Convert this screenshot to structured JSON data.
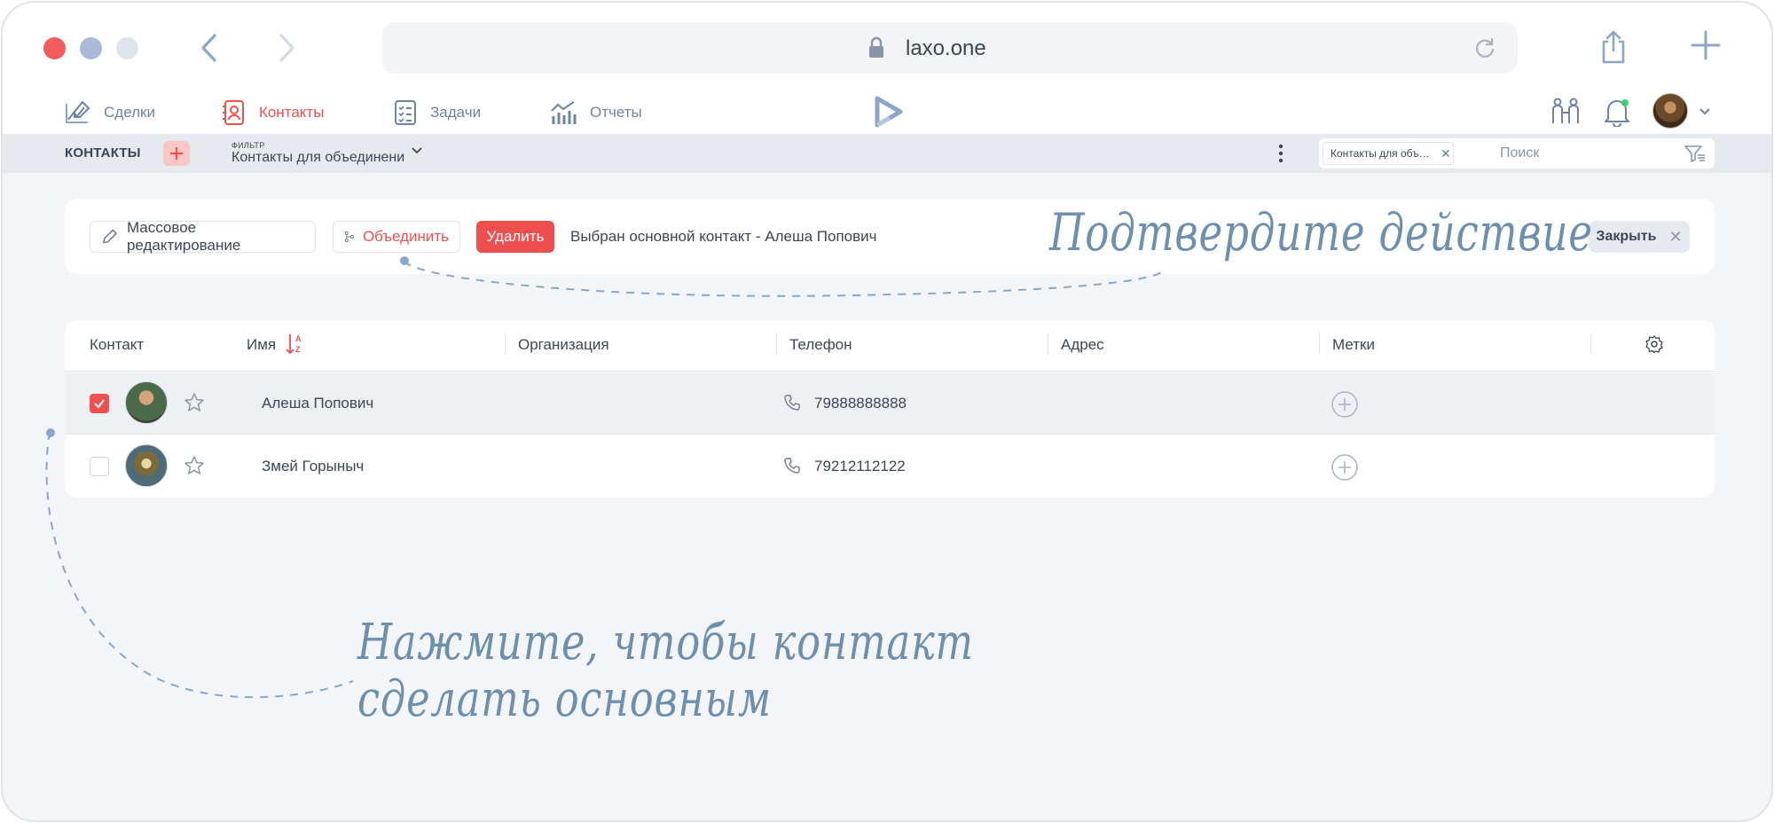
{
  "browser": {
    "url": "laxo.one",
    "icons": [
      "close-dot",
      "minimize-dot",
      "zoom-dot",
      "back-arrow-icon",
      "forward-arrow-icon",
      "lock-icon",
      "reload-icon",
      "share-icon",
      "plus-icon"
    ]
  },
  "nav": {
    "items": [
      {
        "label": "Сделки",
        "icon": "deals-icon",
        "active": false
      },
      {
        "label": "Контакты",
        "icon": "contacts-icon",
        "active": true
      },
      {
        "label": "Задачи",
        "icon": "tasks-icon",
        "active": false
      },
      {
        "label": "Отчеты",
        "icon": "reports-icon",
        "active": false
      }
    ],
    "logo": "laxo-logo",
    "right_icons": [
      "team-icon",
      "bell-icon",
      "avatar",
      "chevron-down-icon"
    ]
  },
  "subbar": {
    "title": "КОНТАКТЫ",
    "filter_label": "ФИЛЬТР",
    "filter_value": "Контакты для объединения",
    "chip_text": "Контакты для объединен...",
    "search_placeholder": "Поиск"
  },
  "actions": {
    "mass_edit": "Массовое редактирование",
    "merge": "Объединить",
    "delete": "Удалить",
    "selected_text": "Выбран основной контакт - Алеша Попович",
    "close": "Закрыть"
  },
  "table": {
    "columns": [
      "Контакт",
      "Имя",
      "Организация",
      "Телефон",
      "Адрес",
      "Метки"
    ],
    "rows": [
      {
        "name": "Алеша Попович",
        "phone": "79888888888",
        "checked": true
      },
      {
        "name": "Змей Горыныч",
        "phone": "79212112122",
        "checked": false
      }
    ]
  },
  "annotations": {
    "confirm": "Подтвердите действие",
    "hint_line1": "Нажмите, чтобы контакт",
    "hint_line2": "сделать основным"
  },
  "colors": {
    "accent": "#ef4f4f",
    "nav_text": "#6f84a3",
    "annotation": "#6f8fae"
  }
}
